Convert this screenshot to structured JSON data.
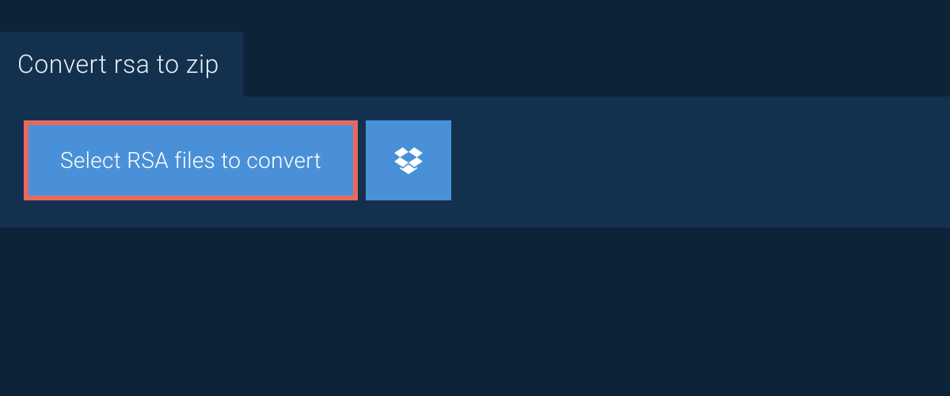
{
  "tab": {
    "title": "Convert rsa to zip"
  },
  "actions": {
    "select_label": "Select RSA files to convert",
    "dropbox_icon_name": "dropbox"
  },
  "colors": {
    "page_bg": "#0d2438",
    "panel_bg": "#13314f",
    "button_bg": "#4a90d9",
    "highlight_border": "#e8695f",
    "text_light": "#e8eef4",
    "text_white": "#ffffff"
  }
}
